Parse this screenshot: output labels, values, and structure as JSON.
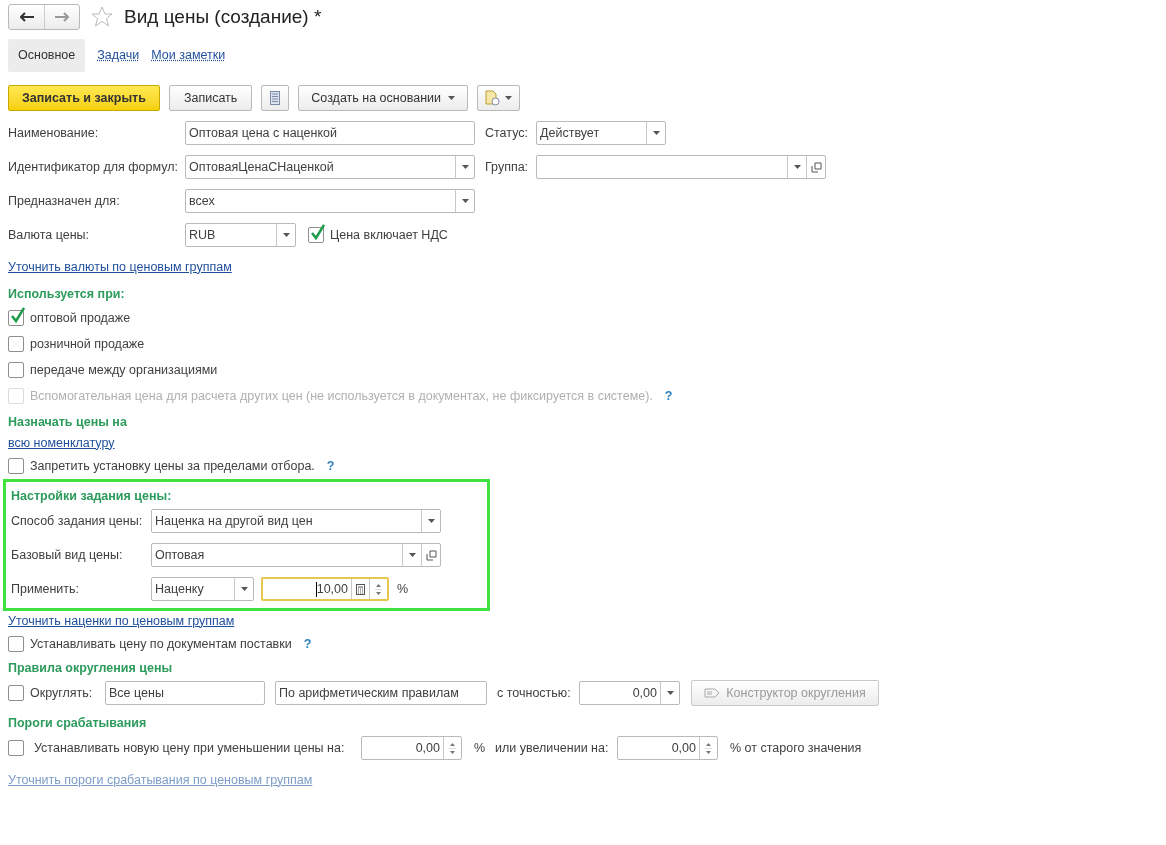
{
  "window": {
    "title": "Вид цены (создание) *",
    "favorite": false
  },
  "tabs": [
    {
      "label": "Основное",
      "selected": true
    },
    {
      "label": "Задачи",
      "selected": false
    },
    {
      "label": "Мои заметки",
      "selected": false
    }
  ],
  "toolbar": {
    "save_close": "Записать и закрыть",
    "save": "Записать",
    "create_based": "Создать на основании"
  },
  "fields": {
    "name": {
      "label": "Наименование:",
      "value": "Оптовая цена с наценкой"
    },
    "status": {
      "label": "Статус:",
      "value": "Действует"
    },
    "formula_id": {
      "label": "Идентификатор для формул:",
      "value": "ОптоваяЦенаСНаценкой"
    },
    "group": {
      "label": "Группа:"
    },
    "purpose": {
      "label": "Предназначен для:",
      "value": "всех"
    },
    "currency": {
      "label": "Валюта цены:",
      "value": "RUB"
    },
    "vat_included": {
      "label": "Цена включает НДС",
      "checked": true
    }
  },
  "currency_link": "Уточнить валюты по ценовым группам",
  "used_in": {
    "heading": "Используется при:",
    "options": [
      {
        "label": "оптовой продаже",
        "checked": true,
        "disabled": false
      },
      {
        "label": "розничной продаже",
        "checked": false,
        "disabled": false
      },
      {
        "label": "передаче между организациями",
        "checked": false,
        "disabled": false
      },
      {
        "label": "Вспомогательная цена для расчета других цен (не используется в документах, не фиксируется в системе).",
        "checked": false,
        "disabled": true,
        "help": "?"
      }
    ]
  },
  "assign": {
    "heading": "Назначать цены на",
    "link": "всю номенклатуру",
    "restrict": {
      "label": "Запретить установку цены за пределами отбора.",
      "checked": false,
      "help": "?"
    }
  },
  "price_settings": {
    "highlighted": true,
    "heading": "Настройки задания цены:",
    "method": {
      "label": "Способ задания цены:",
      "value": "Наценка на другой вид цен"
    },
    "base": {
      "label": "Базовый вид цены:",
      "value": "Оптовая"
    },
    "apply": {
      "label": "Применить:",
      "mode": "Наценку",
      "value": "10,00",
      "focused": true,
      "unit": "%"
    }
  },
  "markup_link": "Уточнить наценки по ценовым группам",
  "supply": {
    "label": "Устанавливать цену по документам поставки",
    "checked": false,
    "help": "?"
  },
  "rounding": {
    "heading": "Правила округления цены",
    "label": "Округлять:",
    "checked": false,
    "scope": "Все цены",
    "rule": "По арифметическим правилам",
    "precision_label": "с точностью:",
    "precision": "0,00",
    "constructor": {
      "label": "Конструктор округления",
      "disabled": true
    }
  },
  "thresholds": {
    "heading": "Пороги срабатывания",
    "label": "Устанавливать новую цену при уменьшении цены на:",
    "checked": false,
    "decrease": "0,00",
    "decrease_unit": "%",
    "increase_label": "или увеличении на:",
    "increase": "0,00",
    "increase_unit": "% от старого значения"
  },
  "thresholds_link": {
    "label": "Уточнить пороги срабатывания по ценовым группам",
    "disabled": true
  }
}
